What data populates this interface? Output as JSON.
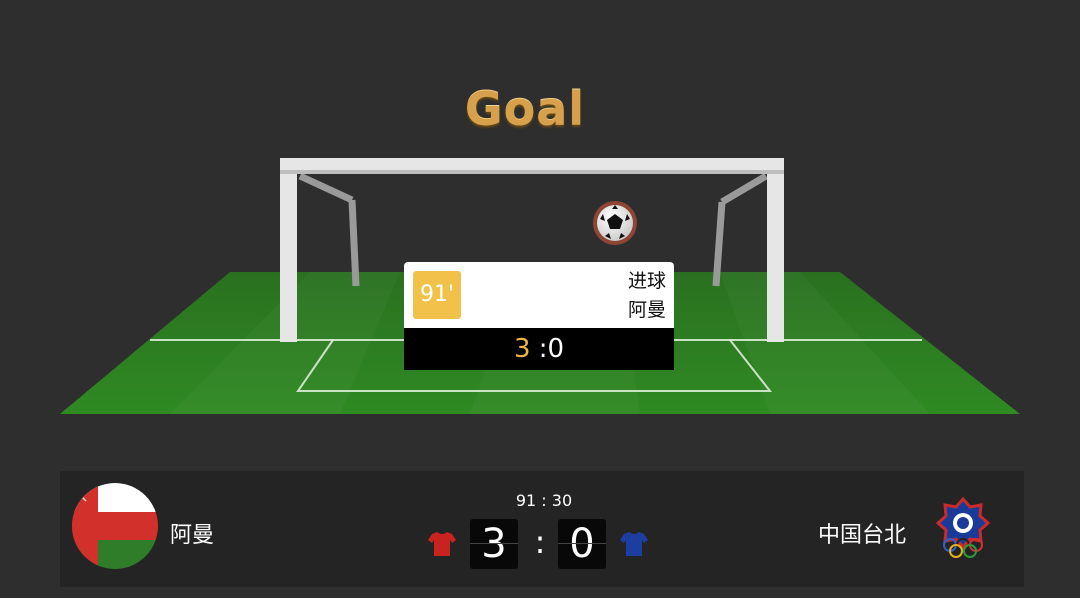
{
  "banner": {
    "title": "Goal"
  },
  "event": {
    "minute": "91'",
    "type": "进球",
    "team": "阿曼",
    "score_home": "3",
    "score_separator": ":",
    "score_away": "0"
  },
  "match": {
    "clock": "91 : 30",
    "home": {
      "name": "阿曼",
      "score": "3",
      "shirt_color": "#c8231e",
      "flag_colors": [
        "#ffffff",
        "#d2302a",
        "#2f7d28"
      ]
    },
    "away": {
      "name": "中国台北",
      "score": "0",
      "shirt_color": "#1b3ea0"
    },
    "separator": ":"
  },
  "colors": {
    "background": "#2e2e2e",
    "pitch": "#2f7f22",
    "title_gold": "#d6a14a",
    "minute_badge": "#f2c14a"
  },
  "icons": [
    "soccer-ball-icon",
    "home-shirt-icon",
    "away-shirt-icon",
    "oman-flag-icon",
    "chinese-taipei-emblem-icon"
  ]
}
